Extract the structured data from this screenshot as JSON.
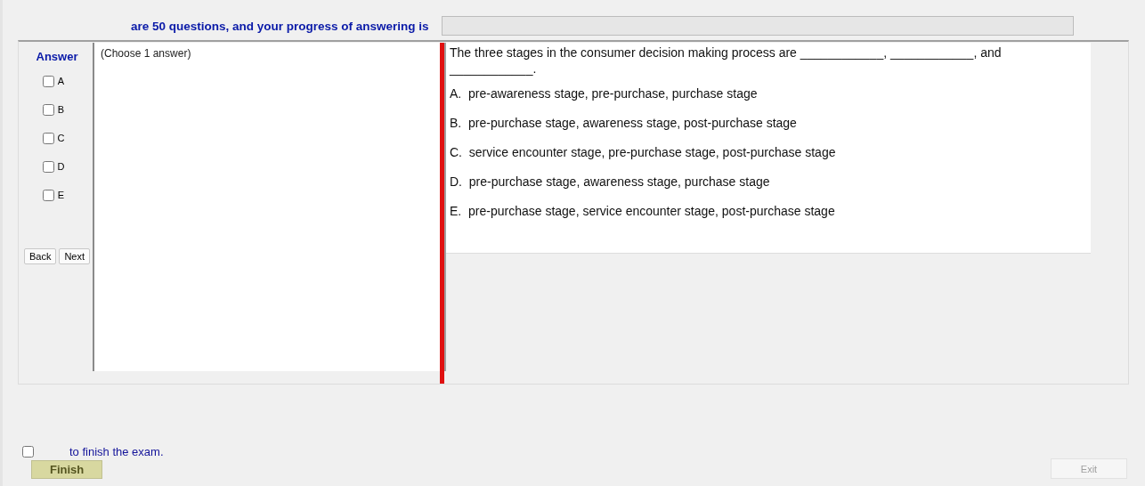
{
  "header": {
    "text": "are 50 questions, and your progress of answering is",
    "progress": {
      "level": 0
    }
  },
  "answer_panel": {
    "title": "Answer",
    "options": [
      {
        "label": "A",
        "checked": false
      },
      {
        "label": "B",
        "checked": false
      },
      {
        "label": "C",
        "checked": false
      },
      {
        "label": "D",
        "checked": false
      },
      {
        "label": "E",
        "checked": false
      }
    ],
    "buttons": [
      {
        "label": "Back",
        "disabled": false
      },
      {
        "label": "Next",
        "disabled": false
      }
    ]
  },
  "instruction": "(Choose 1 answer)",
  "question": {
    "text": "The three stages in the consumer decision making process are ____________, ____________, and ____________.",
    "choices": [
      "A.  pre-awareness stage, pre-purchase, purchase stage",
      "B.  pre-purchase stage, awareness stage, post-purchase stage",
      "C.  service encounter stage, pre-purchase stage, post-purchase stage",
      "D.  pre-purchase stage, awareness stage, purchase stage",
      "E.  pre-purchase stage, service encounter stage, post-purchase stage"
    ]
  },
  "footer": {
    "confirm": {
      "label": "to finish the exam.",
      "checked": false
    },
    "finish_button": {
      "label": "Finish",
      "disabled": false
    },
    "exit_button": {
      "label": "Exit",
      "disabled": true
    }
  }
}
